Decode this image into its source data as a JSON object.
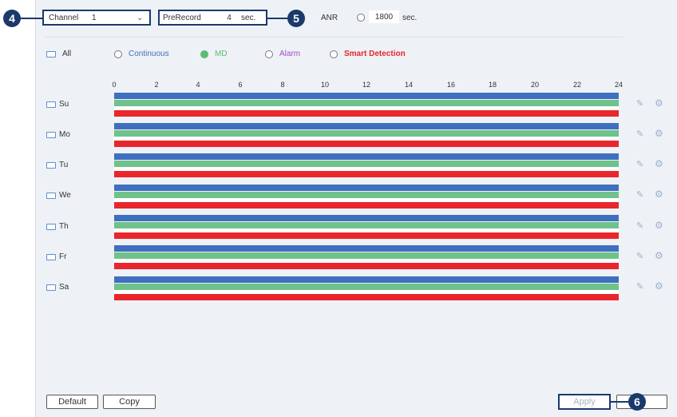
{
  "callouts": {
    "channel": "4",
    "prerecord": "5",
    "apply": "6"
  },
  "top": {
    "channel_label": "Channel",
    "channel_value": "1",
    "prerecord_label": "PreRecord",
    "prerecord_value": "4",
    "prerecord_unit": "sec.",
    "anr_label": "ANR",
    "anr_value": "1800",
    "anr_unit": "sec."
  },
  "legend": {
    "all_label": "All",
    "continuous": "Continuous",
    "md": "MD",
    "alarm": "Alarm",
    "smart": "Smart Detection"
  },
  "colors": {
    "continuous": "#3f70bf",
    "md": "#6fc28a",
    "alarm": "#a04fc9",
    "smart": "#e8262c",
    "callout": "#1b3a6b"
  },
  "hours": [
    "0",
    "2",
    "4",
    "6",
    "8",
    "10",
    "12",
    "14",
    "16",
    "18",
    "20",
    "22",
    "24"
  ],
  "days": [
    "Su",
    "Mo",
    "Tu",
    "We",
    "Th",
    "Fr",
    "Sa"
  ],
  "buttons": {
    "default": "Default",
    "copy": "Copy",
    "apply": "Apply"
  }
}
